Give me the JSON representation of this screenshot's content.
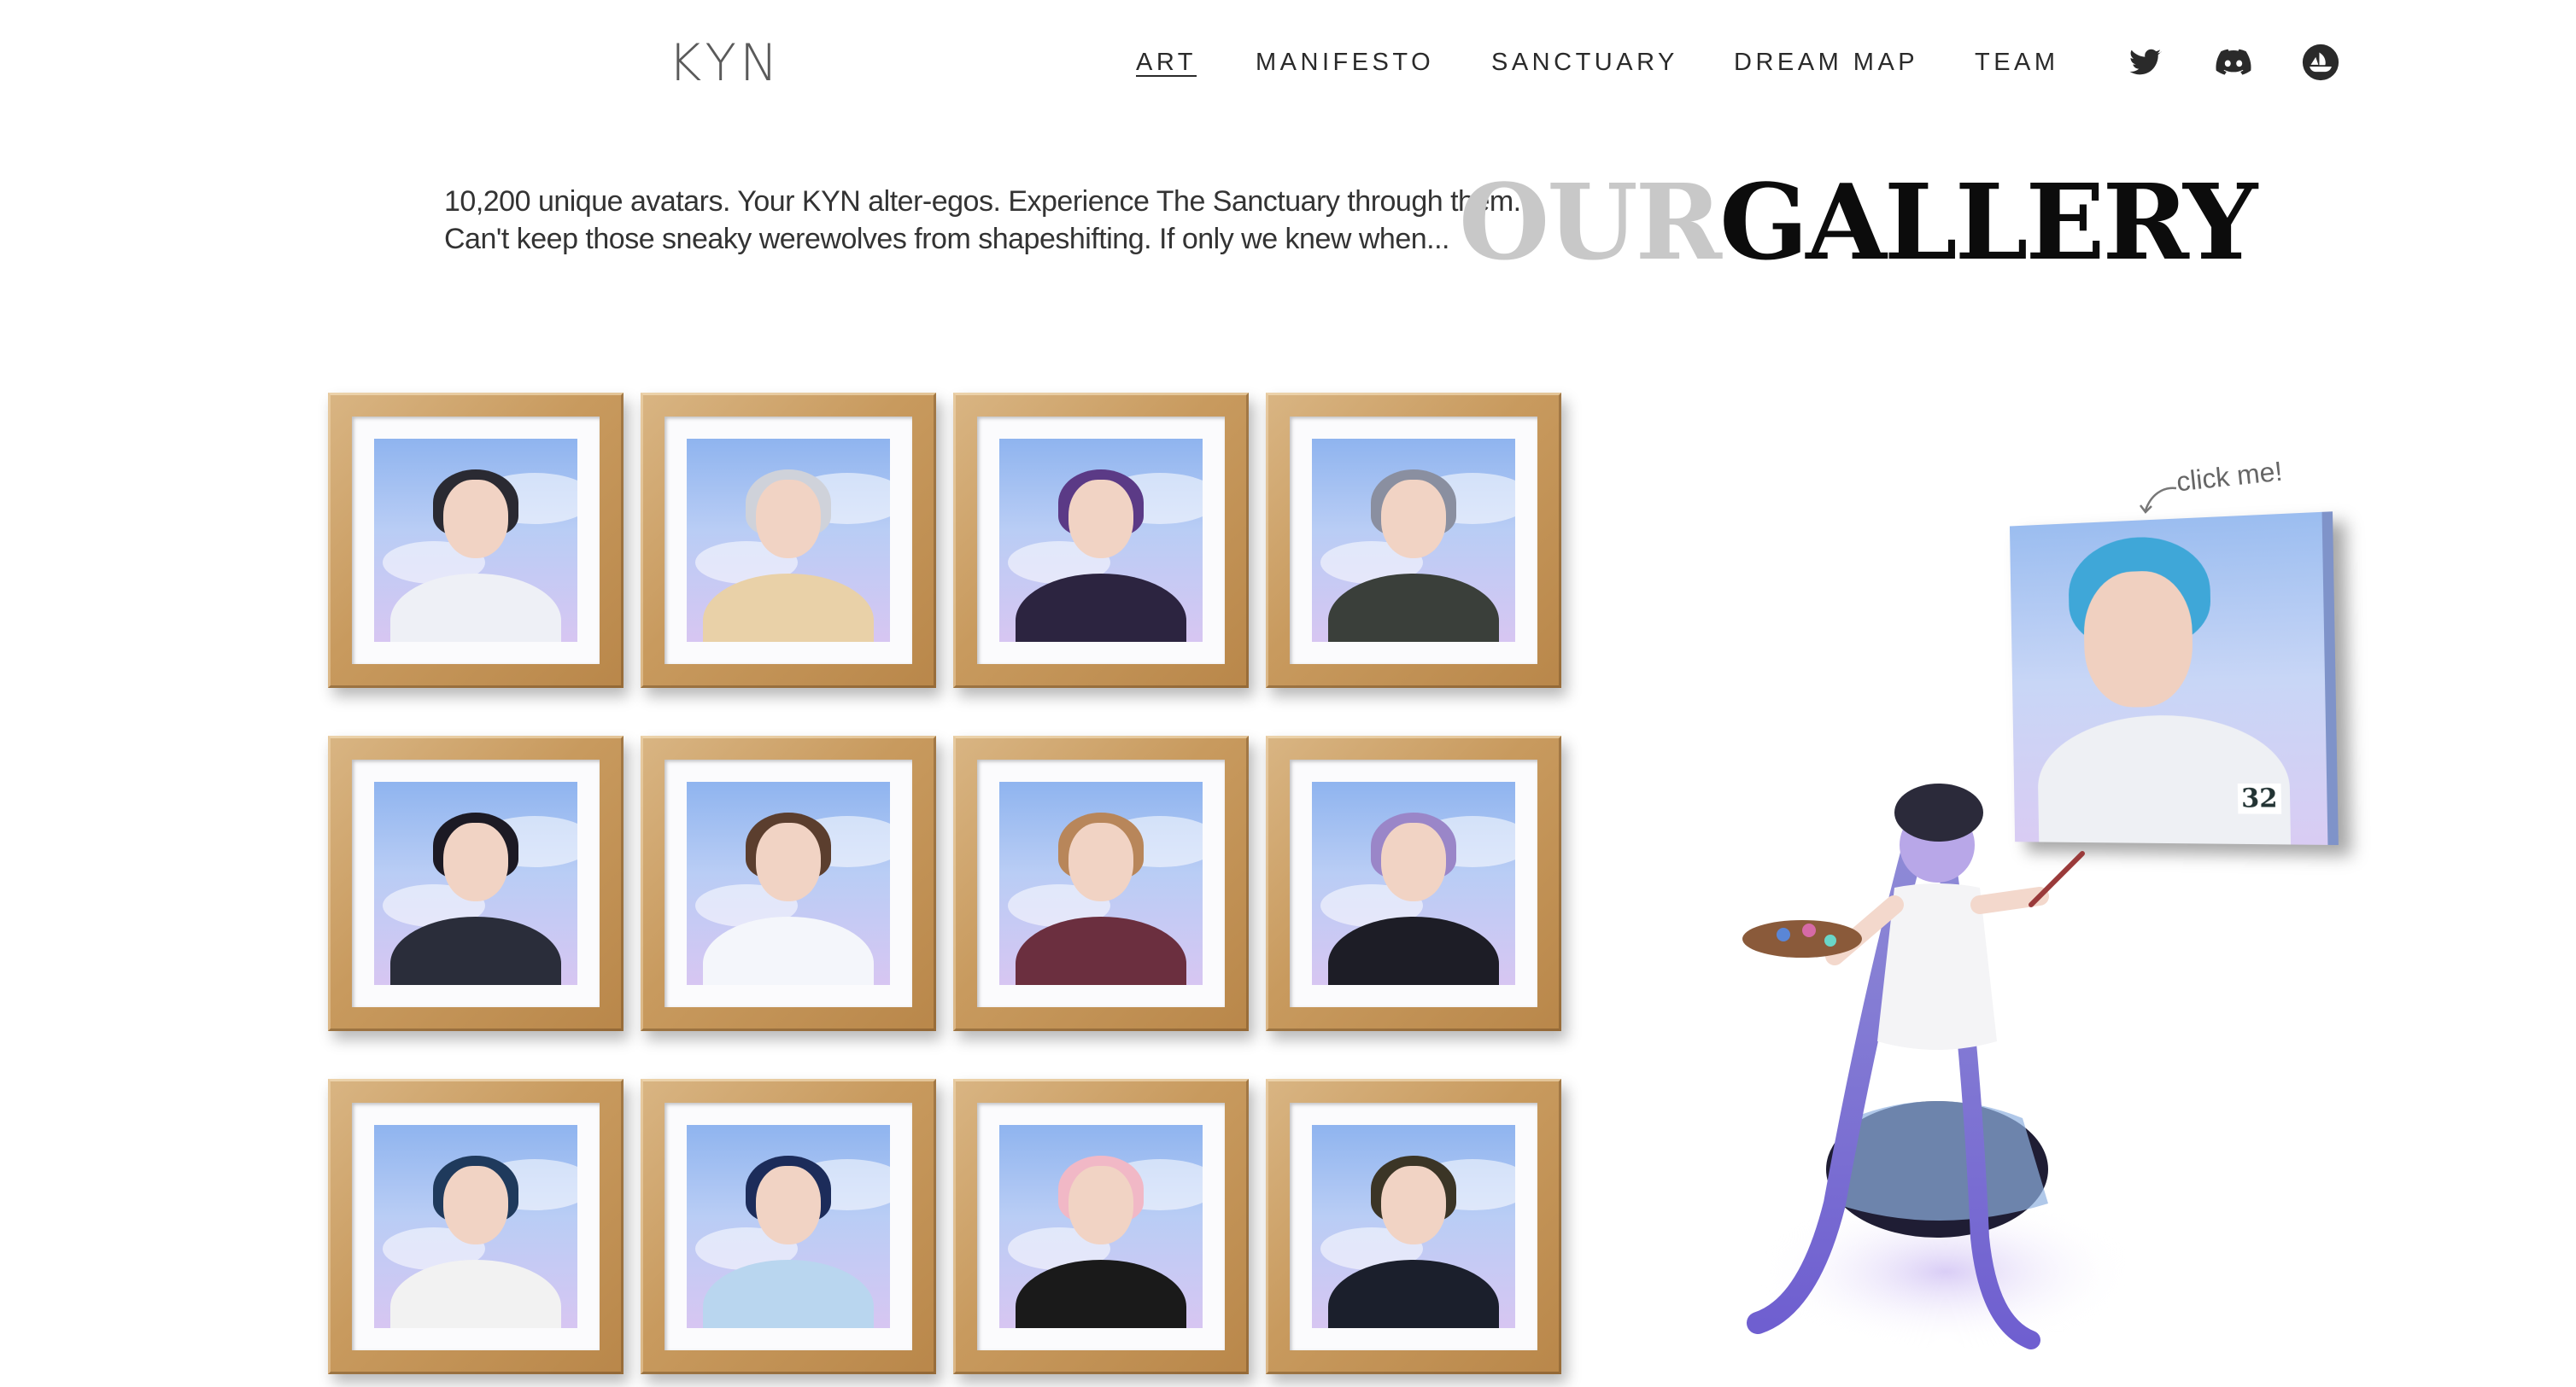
{
  "header": {
    "logo": "KYN",
    "nav": [
      {
        "label": "ART",
        "active": true
      },
      {
        "label": "MANIFESTO",
        "active": false
      },
      {
        "label": "SANCTUARY",
        "active": false
      },
      {
        "label": "DREAM MAP",
        "active": false
      },
      {
        "label": "TEAM",
        "active": false
      }
    ],
    "social_icons": [
      "twitter-icon",
      "discord-icon",
      "opensea-icon"
    ]
  },
  "hero": {
    "tagline_line1": "10,200 unique avatars. Your KYN alter-egos. Experience The Sanctuary through them.",
    "tagline_line2": "Can't keep those sneaky werewolves from shapeshifting. If only we knew when...",
    "title_part1": "OUR",
    "title_part2": "GALLERY"
  },
  "gallery": {
    "frames": [
      {
        "hair": "#2a2a32",
        "outfit": "#eef0f6"
      },
      {
        "hair": "#cfd2da",
        "outfit": "#e9d1a8"
      },
      {
        "hair": "#5b3a86",
        "outfit": "#2c2440"
      },
      {
        "hair": "#8a8fa0",
        "outfit": "#3a3f3a"
      },
      {
        "hair": "#1c1a24",
        "outfit": "#2a2d3a"
      },
      {
        "hair": "#5b3e2e",
        "outfit": "#f4f6fb"
      },
      {
        "hair": "#b8865a",
        "outfit": "#6b2f3f"
      },
      {
        "hair": "#9a86c8",
        "outfit": "#1d1d26"
      },
      {
        "hair": "#1f3a5c",
        "outfit": "#f2f2f2"
      },
      {
        "hair": "#1c2c5a",
        "outfit": "#b9d6ef"
      },
      {
        "hair": "#f1b8c6",
        "outfit": "#1a1a1a"
      },
      {
        "hair": "#3b3526",
        "outfit": "#1b1f2c"
      }
    ]
  },
  "featured": {
    "click_hint": "click me!",
    "badge_number": "32"
  }
}
